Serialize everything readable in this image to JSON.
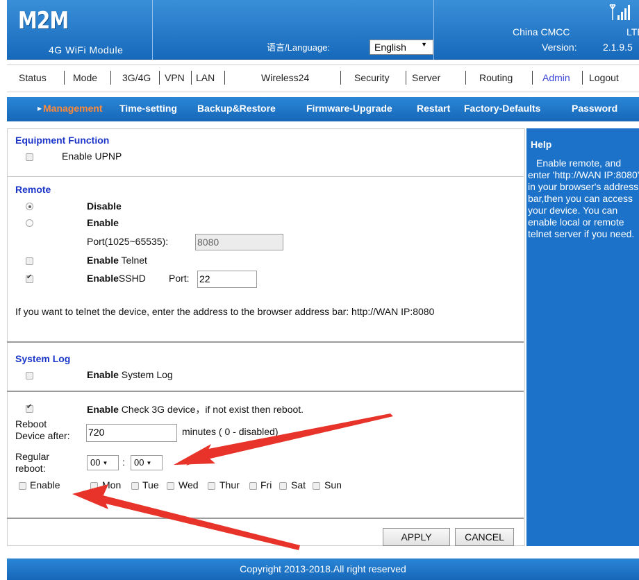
{
  "header": {
    "logo": "M2M",
    "module": "4G WiFi Module",
    "language_label": "语言/Language:",
    "language_value": "English",
    "carrier": "China CMCC",
    "network": "LTE",
    "version_label": "Version:",
    "version": "2.1.9.5"
  },
  "topnav": [
    "Status",
    "Mode",
    "3G/4G",
    "VPN",
    "LAN",
    "Wireless24",
    "Security",
    "Server",
    "Routing",
    "Admin",
    "Logout"
  ],
  "subnav": [
    "Management",
    "Time-setting",
    "Backup&Restore",
    "Firmware-Upgrade",
    "Restart",
    "Factory-Defaults",
    "Password"
  ],
  "equipment": {
    "title": "Equipment Function",
    "upnp_label": "Enable UPNP",
    "upnp_checked": false
  },
  "remote": {
    "title": "Remote",
    "disable_label": "Disable",
    "enable_label": "Enable",
    "selected": "Disable",
    "port_label": "Port(1025~65535):",
    "port_value": "8080",
    "telnet_bold": "Enable",
    "telnet_rest": " Telnet",
    "telnet_checked": false,
    "sshd_bold": "Enable",
    "sshd_rest": "SSHD",
    "sshd_port_label": "Port:",
    "sshd_port_value": "22",
    "sshd_checked": true,
    "note": "If you want to telnet the device, enter the address to the browser address bar: http://WAN IP:8080"
  },
  "syslog": {
    "title": "System Log",
    "enable_bold": "Enable",
    "enable_rest": " System Log",
    "checked": false
  },
  "reboot": {
    "check_bold": "Enable",
    "check_rest": " Check 3G device，if not exist then reboot.",
    "check_checked": true,
    "after_label_1": "Reboot",
    "after_label_2": "Device after:",
    "after_value": "720",
    "after_unit": "minutes ( 0 - disabled)",
    "regular_label_1": "Regular",
    "regular_label_2": "reboot:",
    "hour": "00",
    "minute": "00",
    "colon": ":",
    "enable_label": "Enable",
    "enable_checked": false,
    "days": [
      "Mon",
      "Tue",
      "Wed",
      "Thur",
      "Fri",
      "Sat",
      "Sun"
    ]
  },
  "buttons": {
    "apply": "APPLY",
    "cancel": "CANCEL"
  },
  "help": {
    "title": "Help",
    "text": "Enable remote, and enter 'http://WAN IP:8080' in your browser's address bar,then you can access your device. You can enable local or remote telnet server if you need."
  },
  "footer": "Copyright 2013-2018.All right reserved",
  "colors": {
    "brand_blue": "#1b72c8",
    "section_blue": "#1a35c8",
    "active_subnav": "#ff8a3a",
    "annotation_red": "#e8332a"
  }
}
